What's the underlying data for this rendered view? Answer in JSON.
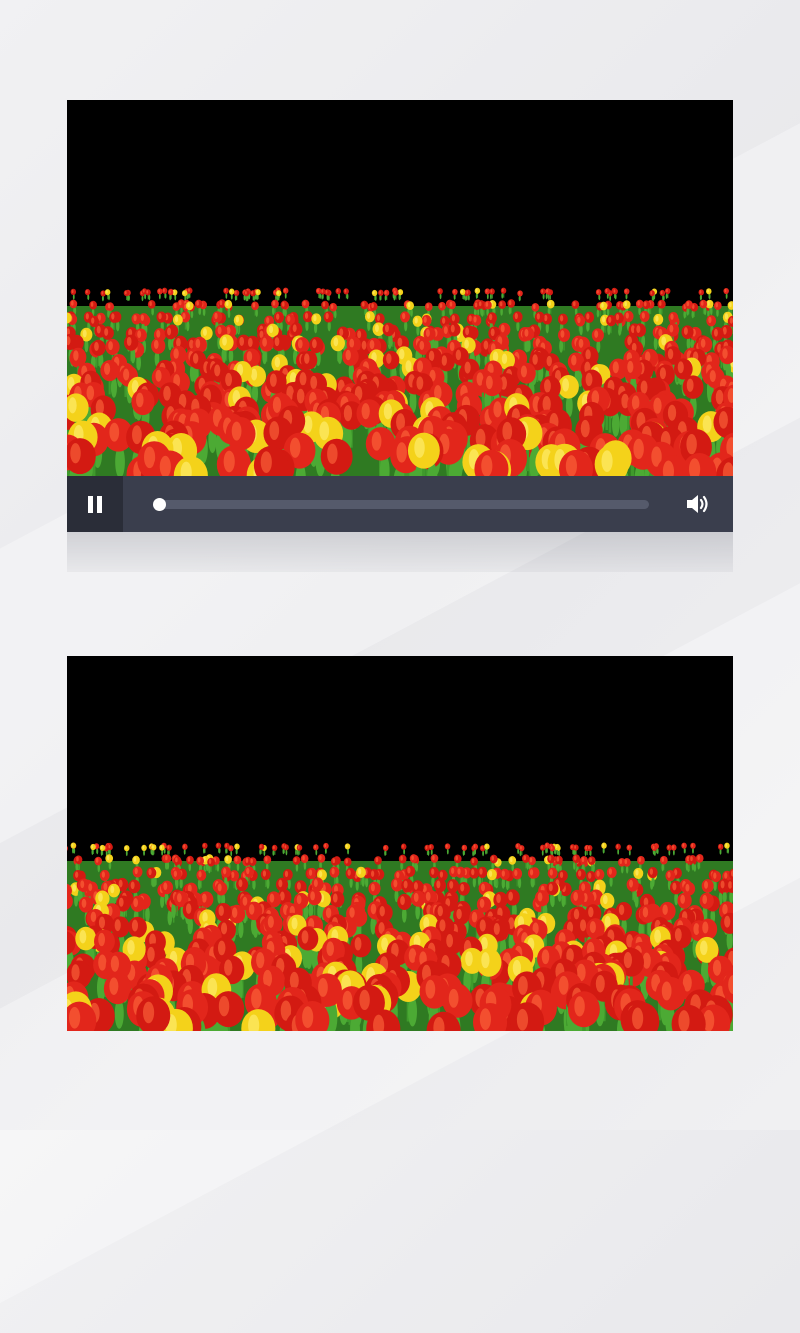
{
  "player": {
    "state": "playing",
    "progress": 0.0,
    "pause_icon": "pause-icon",
    "volume_icon": "speaker-volume-icon"
  },
  "colors": {
    "video_background": "#000000",
    "controls_background": "#3a3e4d",
    "pause_button_background": "#2a2d38",
    "track": "#555a6b",
    "knob": "#ffffff",
    "tulip_red": "#e2261b",
    "tulip_yellow": "#f4d21a",
    "leaf_green": "#3f9a2c"
  }
}
